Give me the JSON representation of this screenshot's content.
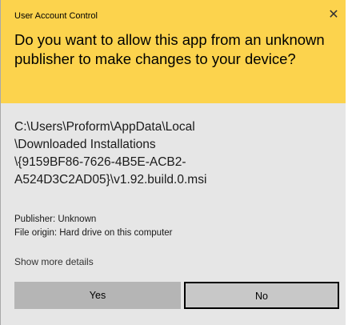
{
  "window": {
    "title": "User Account Control",
    "close_glyph": "✕"
  },
  "header": {
    "question": "Do you want to allow this app from an unknown publisher to make changes to your device?",
    "background_color": "#fcd34d"
  },
  "program": {
    "path_lines": [
      "C:\\Users\\Proform\\AppData\\Local",
      "\\Downloaded Installations",
      "\\{9159BF86-7626-4B5E-ACB2-",
      "A524D3C2AD05}\\v1.92.build.0.msi"
    ]
  },
  "details": {
    "publisher": "Publisher: Unknown",
    "file_origin": "File origin: Hard drive on this computer",
    "show_more": "Show more details"
  },
  "buttons": {
    "yes": "Yes",
    "no": "No"
  },
  "icons": {
    "close": "close-icon"
  }
}
